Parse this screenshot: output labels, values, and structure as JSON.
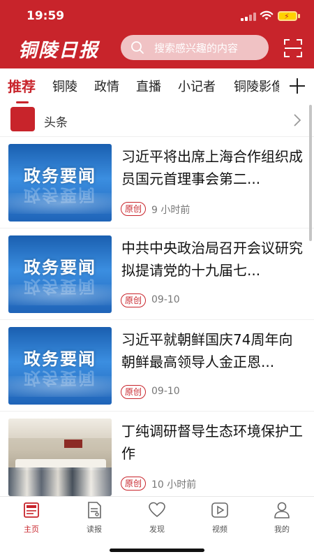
{
  "status_bar": {
    "time": "19:59"
  },
  "header": {
    "logo": "铜陵日报",
    "search_placeholder": "搜索感兴趣的内容",
    "brand_color": "#c8242b"
  },
  "tabs": {
    "items": [
      "推荐",
      "铜陵",
      "政情",
      "直播",
      "小记者",
      "铜陵影像"
    ],
    "active": "推荐"
  },
  "headline_row": {
    "label": "头条"
  },
  "news": [
    {
      "thumb_text": "政务要闻",
      "title": "习近平将出席上海合作组织成员国元首理事会第二...",
      "badge": "原创",
      "time": "9 小时前"
    },
    {
      "thumb_text": "政务要闻",
      "title": "中共中央政治局召开会议研究拟提请党的十九届七...",
      "badge": "原创",
      "time": "09-10"
    },
    {
      "thumb_text": "政务要闻",
      "title": "习近平就朝鲜国庆74周年向朝鲜最高领导人金正恩...",
      "badge": "原创",
      "time": "09-10"
    },
    {
      "thumb_text": "",
      "title": "丁纯调研督导生态环境保护工作",
      "badge": "原创",
      "time": "10 小时前"
    }
  ],
  "bottom_nav": {
    "items": [
      {
        "label": "主页",
        "icon": "news-icon"
      },
      {
        "label": "读报",
        "icon": "newspaper-icon"
      },
      {
        "label": "发现",
        "icon": "heart-icon"
      },
      {
        "label": "视频",
        "icon": "play-icon"
      },
      {
        "label": "我的",
        "icon": "person-icon"
      }
    ],
    "active": "主页"
  }
}
